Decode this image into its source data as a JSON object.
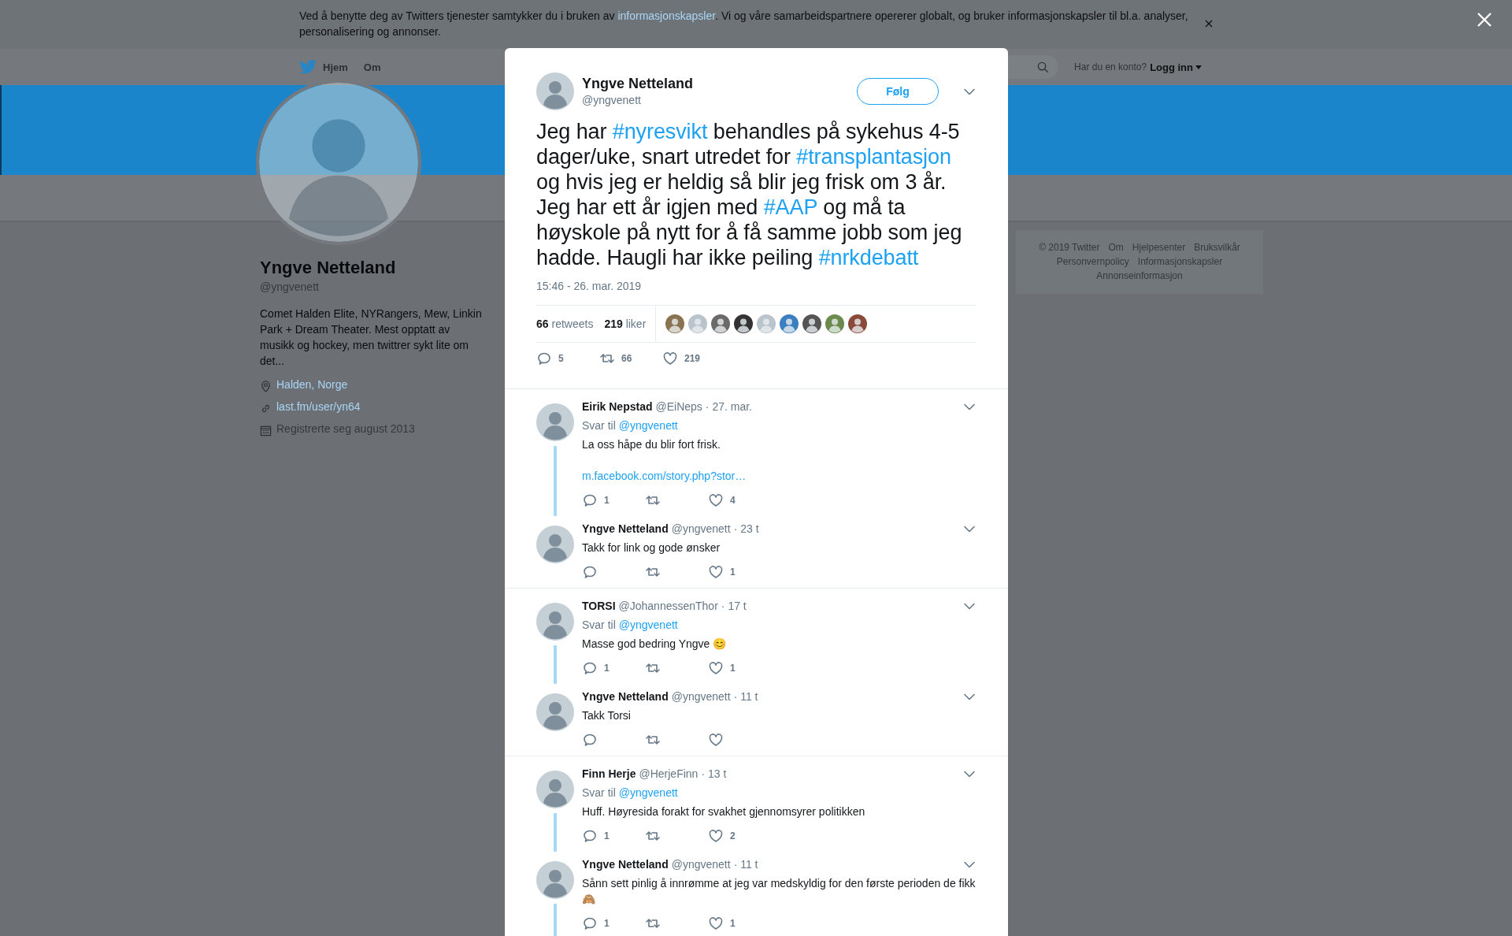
{
  "cookie_banner": {
    "segments": [
      {
        "text": "Ved å benytte deg av Twitters tjenester samtykker du i bruken av "
      },
      {
        "text": "informasjonskapsler",
        "kind": "link"
      },
      {
        "text": ". Vi og våre samarbeidspartnere opererer globalt, og bruker informasjonskapsler til bl.a. analyser, personalisering og annonser."
      }
    ]
  },
  "nav": {
    "items": [
      {
        "label": "Hjem"
      },
      {
        "label": "Om"
      }
    ],
    "account_prompt": "Har du en konto?",
    "login": "Logg inn"
  },
  "profile": {
    "name": "Yngve Netteland",
    "handle": "@yngvenett",
    "bio": "Comet Halden Elite, NYRangers, Mew, Linkin Park + Dream Theater. Mest opptatt av musikk og hockey, men twittrer sykt lite om det...",
    "location": "Halden, Norge",
    "url": "last.fm/user/yn64",
    "joined": "Registrerte seg august 2013"
  },
  "footer_links": [
    "© 2019 Twitter",
    "Om",
    "Hjelpesenter",
    "Bruksvilkår",
    "Personvernpolicy",
    "Informasjonskapsler",
    "Annonseinformasjon"
  ],
  "tweet": {
    "name": "Yngve Netteland",
    "handle": "@yngvenett",
    "follow": "Følg",
    "segments": [
      {
        "text": "Jeg har "
      },
      {
        "text": "#nyresvikt",
        "kind": "hashtag"
      },
      {
        "text": " behandles på sykehus 4-5 dager/uke, snart utredet for "
      },
      {
        "text": "#transplantasjon",
        "kind": "hashtag"
      },
      {
        "text": " og hvis jeg er heldig så blir jeg frisk om 3 år. Jeg har ett år igjen med "
      },
      {
        "text": "#AAP",
        "kind": "hashtag"
      },
      {
        "text": " og må ta høyskole på nytt for å få samme jobb som jeg hadde. Haugli har ikke peiling "
      },
      {
        "text": "#nrkdebatt",
        "kind": "hashtag"
      }
    ],
    "timestamp": "15:46 - 26. mar. 2019",
    "stats": [
      {
        "count": "66",
        "label": "retweets"
      },
      {
        "count": "219",
        "label": "liker"
      }
    ],
    "actions": {
      "replies": "5",
      "retweets": "66",
      "likes": "219"
    }
  },
  "conversations": [
    {
      "replies": [
        {
          "name": "Eirik Nepstad",
          "handle": "@EiNeps",
          "time": "· 27. mar.",
          "reply_label": "Svar til",
          "reply_to": "@yngvenett",
          "text": "La oss håpe du blir fort frisk.",
          "link": "m.facebook.com/story.php?stor…",
          "actions": {
            "replies": "1",
            "likes": "4"
          },
          "connected": true
        },
        {
          "name": "Yngve Netteland",
          "handle": "@yngvenett",
          "time": "· 23 t",
          "text": "Takk for link og gode ønsker",
          "actions": {
            "likes": "1"
          },
          "connected": false
        }
      ]
    },
    {
      "replies": [
        {
          "name": "TORSI",
          "handle": "@JohannessenThor",
          "time": "· 17 t",
          "reply_label": "Svar til",
          "reply_to": "@yngvenett",
          "text": "Masse god bedring Yngve 😊",
          "actions": {
            "replies": "1",
            "likes": "1"
          },
          "connected": true
        },
        {
          "name": "Yngve Netteland",
          "handle": "@yngvenett",
          "time": "· 11 t",
          "text": "Takk Torsi",
          "connected": false
        }
      ]
    },
    {
      "replies": [
        {
          "name": "Finn Herje",
          "handle": "@HerjeFinn",
          "time": "· 13 t",
          "reply_label": "Svar til",
          "reply_to": "@yngvenett",
          "text": "Huff. Høyresida forakt for svakhet gjennomsyrer politikken",
          "actions": {
            "replies": "1",
            "likes": "2"
          },
          "connected": true
        },
        {
          "name": "Yngve Netteland",
          "handle": "@yngvenett",
          "time": "· 11 t",
          "text": "Sånn sett pinlig å innrømme at jeg var medskyldig for den første perioden de fikk 🙈",
          "actions": {
            "replies": "1",
            "likes": "1"
          },
          "connected": true
        }
      ]
    }
  ]
}
